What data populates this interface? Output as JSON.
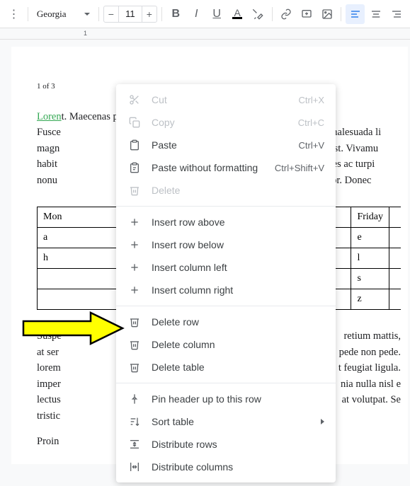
{
  "toolbar": {
    "font": "Georgia",
    "fontSize": "11"
  },
  "ruler": {
    "mark1": "1"
  },
  "document": {
    "pageCounter": "1 of 3",
    "loremLabel": "Loren",
    "para1": "t. Maecenas po\nFusce                                                                                                     is malesuada li\nmagn                                                                                                   sce est. Vivamu\nhabit                                                                                                     fames ac turpi\nnonu                                                                                                   orttitor. Donec",
    "table": {
      "headers": [
        "Mon",
        "Friday"
      ],
      "rows": [
        [
          "a",
          "e"
        ],
        [
          "h",
          "l"
        ],
        [
          "",
          "s"
        ],
        [
          "",
          "z"
        ]
      ]
    },
    "para2_lines": [
      "Suspe",
      "at ser",
      "lorem",
      "imper",
      "lectus",
      "tristic"
    ],
    "para2_right": [
      "retium mattis,",
      "pede non pede.",
      "t feugiat ligula.",
      "nia nulla nisl e",
      "at volutpat. Se"
    ],
    "para3": "Proin"
  },
  "menu": {
    "items": [
      {
        "icon": "cut",
        "label": "Cut",
        "shortcut": "Ctrl+X",
        "disabled": true
      },
      {
        "icon": "copy",
        "label": "Copy",
        "shortcut": "Ctrl+C",
        "disabled": true
      },
      {
        "icon": "paste",
        "label": "Paste",
        "shortcut": "Ctrl+V",
        "disabled": false
      },
      {
        "icon": "paste-nf",
        "label": "Paste without formatting",
        "shortcut": "Ctrl+Shift+V",
        "disabled": false
      },
      {
        "icon": "trash",
        "label": "Delete",
        "shortcut": "",
        "disabled": true
      },
      {
        "divider": true
      },
      {
        "icon": "plus",
        "label": "Insert row above",
        "shortcut": "",
        "disabled": false
      },
      {
        "icon": "plus",
        "label": "Insert row below",
        "shortcut": "",
        "disabled": false
      },
      {
        "icon": "plus",
        "label": "Insert column left",
        "shortcut": "",
        "disabled": false
      },
      {
        "icon": "plus",
        "label": "Insert column right",
        "shortcut": "",
        "disabled": false
      },
      {
        "divider": true
      },
      {
        "icon": "trash",
        "label": "Delete row",
        "shortcut": "",
        "disabled": false
      },
      {
        "icon": "trash",
        "label": "Delete column",
        "shortcut": "",
        "disabled": false
      },
      {
        "icon": "trash",
        "label": "Delete table",
        "shortcut": "",
        "disabled": false
      },
      {
        "divider": true
      },
      {
        "icon": "pin",
        "label": "Pin header up to this row",
        "shortcut": "",
        "disabled": false
      },
      {
        "icon": "sort",
        "label": "Sort table",
        "shortcut": "",
        "disabled": false,
        "submenu": true
      },
      {
        "icon": "dist",
        "label": "Distribute rows",
        "shortcut": "",
        "disabled": false
      },
      {
        "icon": "dist-c",
        "label": "Distribute columns",
        "shortcut": "",
        "disabled": false
      }
    ]
  }
}
